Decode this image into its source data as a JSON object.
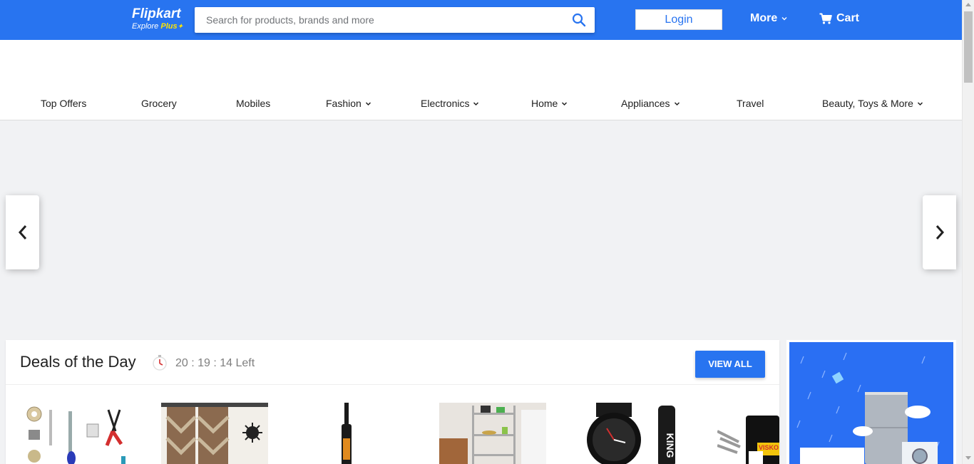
{
  "header": {
    "logo_main": "Flipkart",
    "logo_explore": "Explore",
    "logo_plus": "Plus",
    "search_placeholder": "Search for products, brands and more",
    "login_label": "Login",
    "more_label": "More",
    "cart_label": "Cart",
    "brand_color": "#2874f0"
  },
  "nav": {
    "items": [
      {
        "label": "Top Offers",
        "has_dropdown": false
      },
      {
        "label": "Grocery",
        "has_dropdown": false
      },
      {
        "label": "Mobiles",
        "has_dropdown": false
      },
      {
        "label": "Fashion",
        "has_dropdown": true
      },
      {
        "label": "Electronics",
        "has_dropdown": true
      },
      {
        "label": "Home",
        "has_dropdown": true
      },
      {
        "label": "Appliances",
        "has_dropdown": true
      },
      {
        "label": "Travel",
        "has_dropdown": false
      },
      {
        "label": "Beauty, Toys & More",
        "has_dropdown": true
      }
    ]
  },
  "carousel": {
    "prev_icon": "chevron-left-icon",
    "next_icon": "chevron-right-icon"
  },
  "deals": {
    "title": "Deals of the Day",
    "timer": "20 : 19 : 14 Left",
    "view_all_label": "VIEW ALL",
    "products": [
      {
        "image": "soldering-kit"
      },
      {
        "image": "curtain"
      },
      {
        "image": "cricket-bat"
      },
      {
        "image": "storage-rack"
      },
      {
        "image": "wrist-watch-combo"
      },
      {
        "image": "tool-kit"
      }
    ]
  },
  "ad": {
    "image": "appliances-monsoon-banner"
  }
}
